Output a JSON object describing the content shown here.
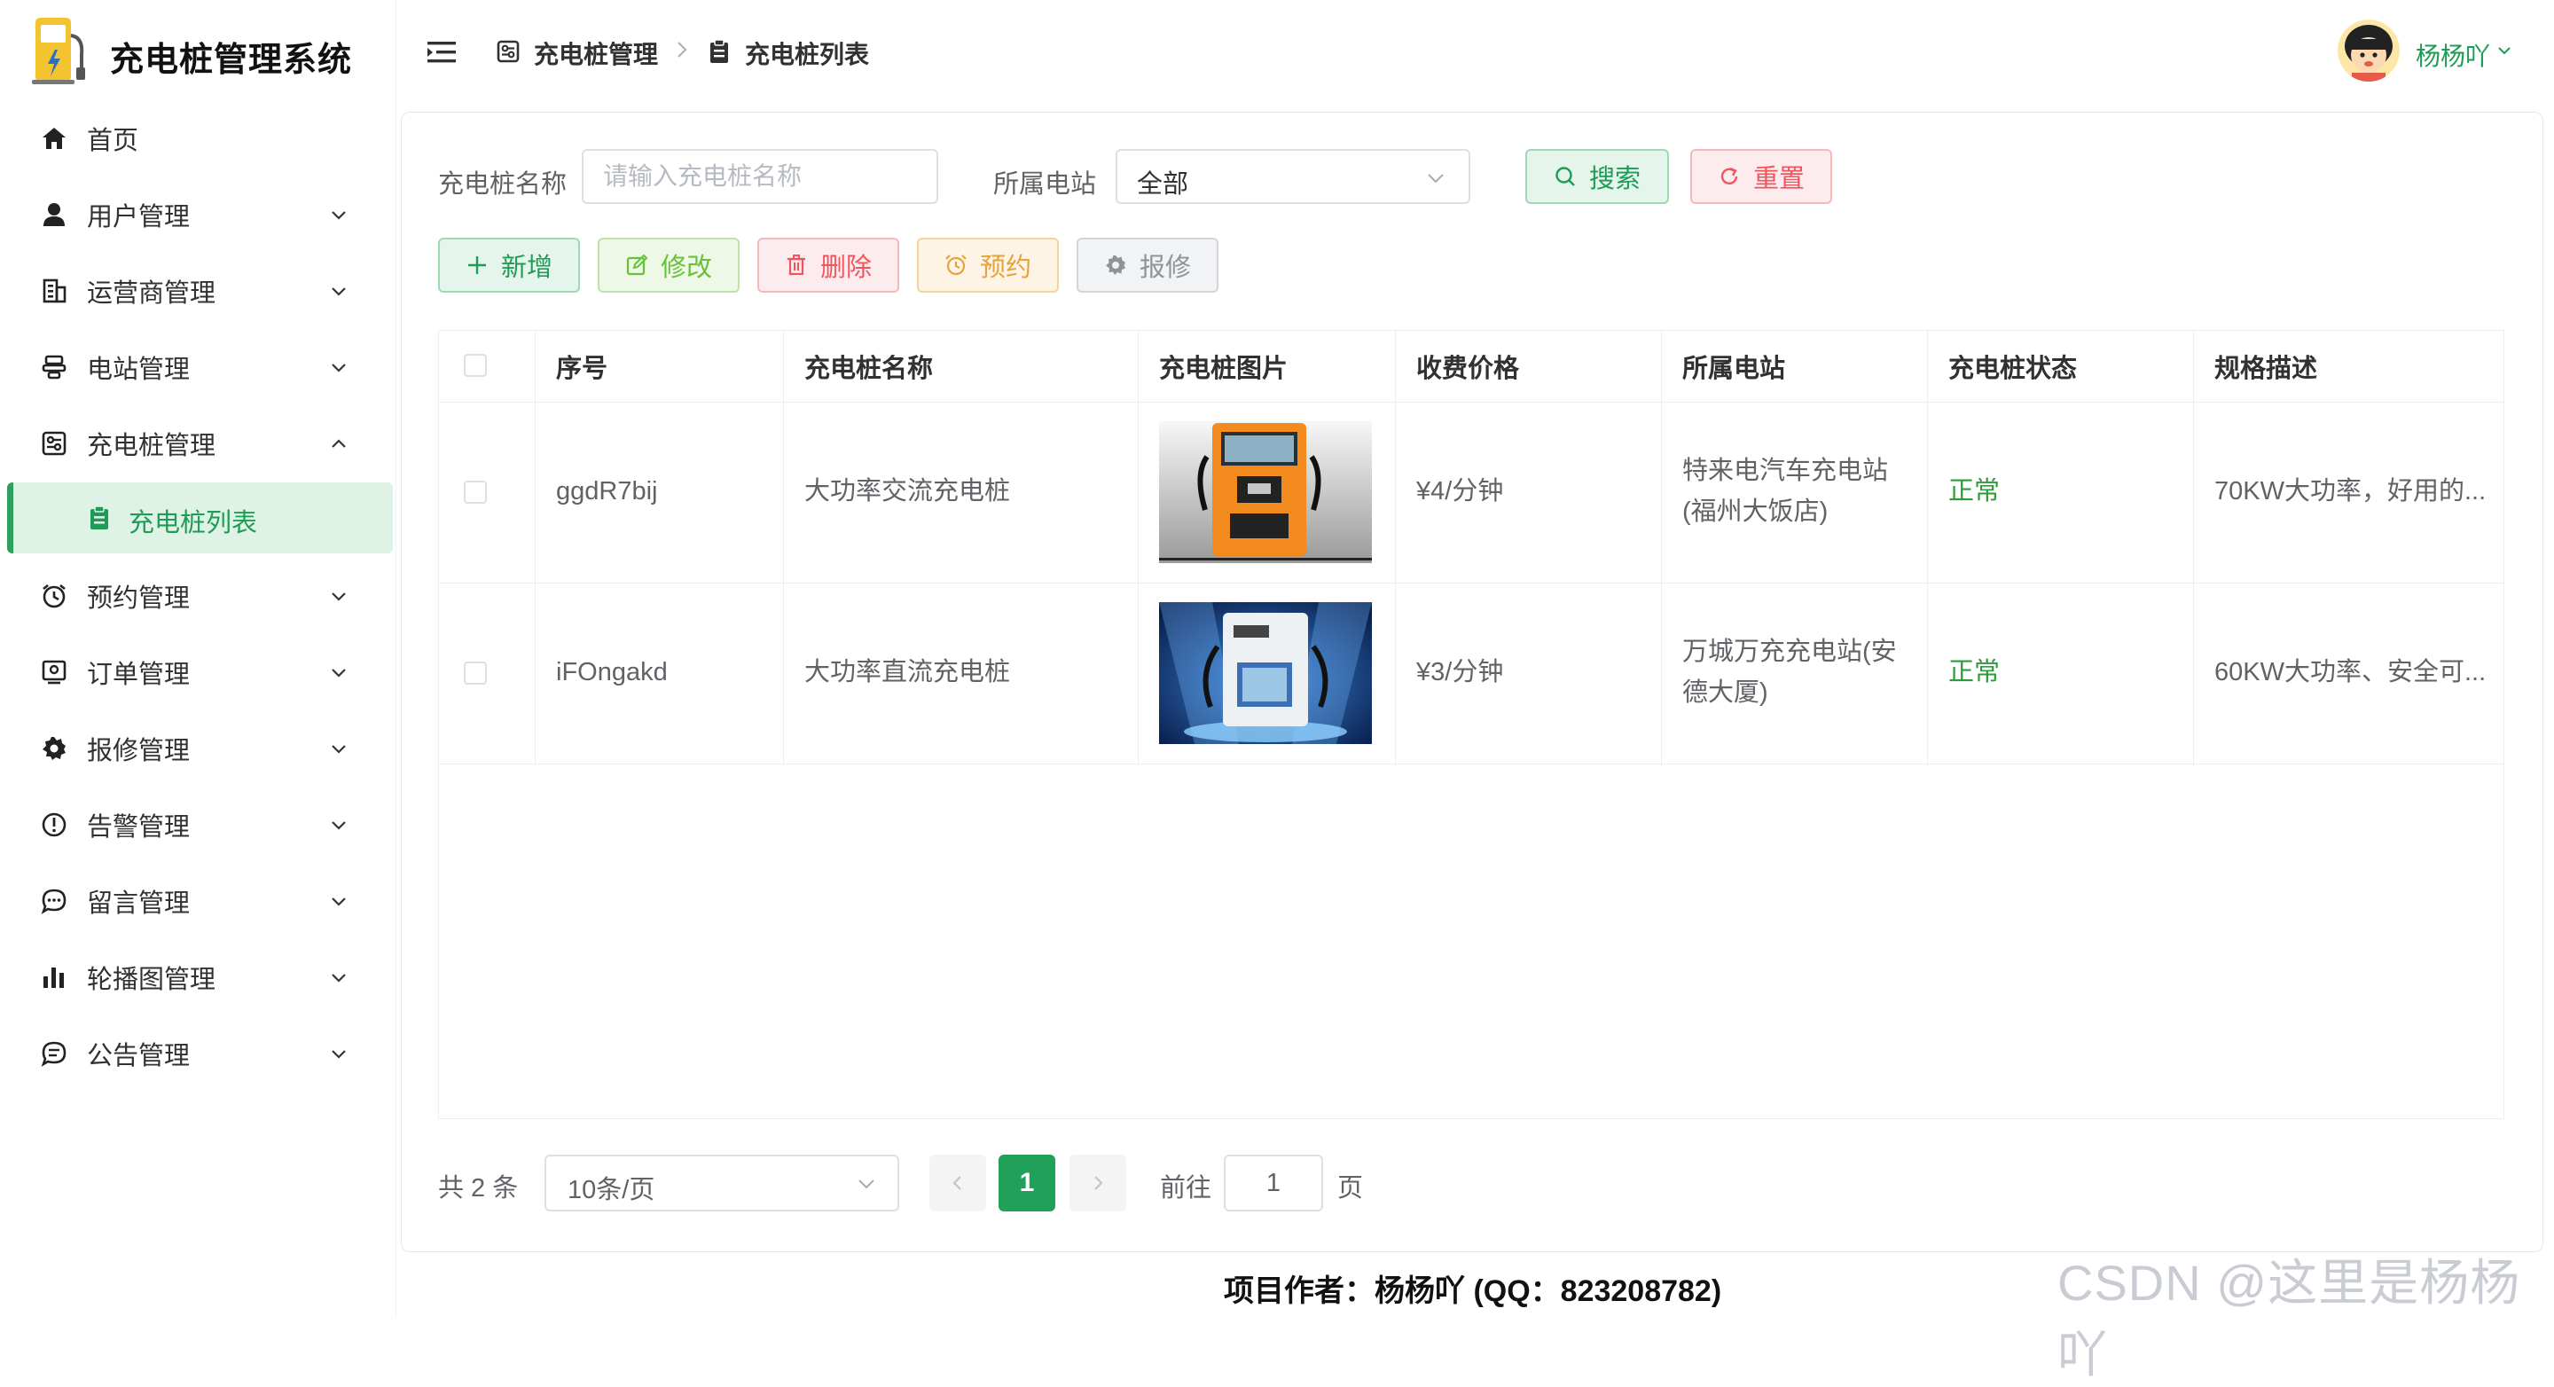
{
  "app": {
    "title": "充电桩管理系统"
  },
  "sidebar": {
    "items": [
      {
        "label": "首页",
        "icon": "home-icon"
      },
      {
        "label": "用户管理",
        "icon": "user-icon"
      },
      {
        "label": "运营商管理",
        "icon": "building-icon"
      },
      {
        "label": "电站管理",
        "icon": "station-icon"
      },
      {
        "label": "充电桩管理",
        "icon": "charger-icon"
      },
      {
        "label": "预约管理",
        "icon": "alarm-clock-icon"
      },
      {
        "label": "订单管理",
        "icon": "order-icon"
      },
      {
        "label": "报修管理",
        "icon": "gear-icon"
      },
      {
        "label": "告警管理",
        "icon": "warning-icon"
      },
      {
        "label": "留言管理",
        "icon": "message-icon"
      },
      {
        "label": "轮播图管理",
        "icon": "bar-chart-icon"
      },
      {
        "label": "公告管理",
        "icon": "notice-icon"
      }
    ],
    "sub_item": {
      "label": "充电桩列表",
      "icon": "clipboard-icon"
    }
  },
  "header": {
    "breadcrumb": [
      "充电桩管理",
      "充电桩列表"
    ],
    "user": {
      "name": "杨杨吖"
    }
  },
  "search": {
    "name_label": "充电桩名称",
    "name_placeholder": "请输入充电桩名称",
    "name_value": "",
    "station_label": "所属电站",
    "station_value": "全部",
    "search_label": "搜索",
    "reset_label": "重置"
  },
  "toolbar": {
    "add_label": "新增",
    "edit_label": "修改",
    "delete_label": "删除",
    "reserve_label": "预约",
    "repair_label": "报修"
  },
  "table": {
    "columns": [
      "序号",
      "充电桩名称",
      "充电桩图片",
      "收费价格",
      "所属电站",
      "充电桩状态",
      "规格描述"
    ],
    "rows": [
      {
        "id": "ggdR7bij",
        "name": "大功率交流充电桩",
        "price": "¥4/分钟",
        "station_line1": "特来电汽车充电站",
        "station_line2": "(福州大饭店)",
        "status": "正常",
        "spec": "70KW大功率，好用的..."
      },
      {
        "id": "iFOngakd",
        "name": "大功率直流充电桩",
        "price": "¥3/分钟",
        "station_line1": "万城万充充电站(安",
        "station_line2": "德大厦)",
        "status": "正常",
        "spec": "60KW大功率、安全可..."
      }
    ]
  },
  "pagination": {
    "total": "共 2 条",
    "page_size": "10条/页",
    "current": "1",
    "goto_label": "前往",
    "goto_value": "1",
    "page_label": "页"
  },
  "footer": {
    "text": "项目作者：杨杨吖 (QQ：823208782)"
  },
  "watermark": {
    "text": "CSDN @这里是杨杨吖"
  },
  "colors": {
    "accent": "#1e9c55",
    "danger": "#f1545e",
    "warning": "#e6a23c",
    "lime": "#67c23a"
  }
}
